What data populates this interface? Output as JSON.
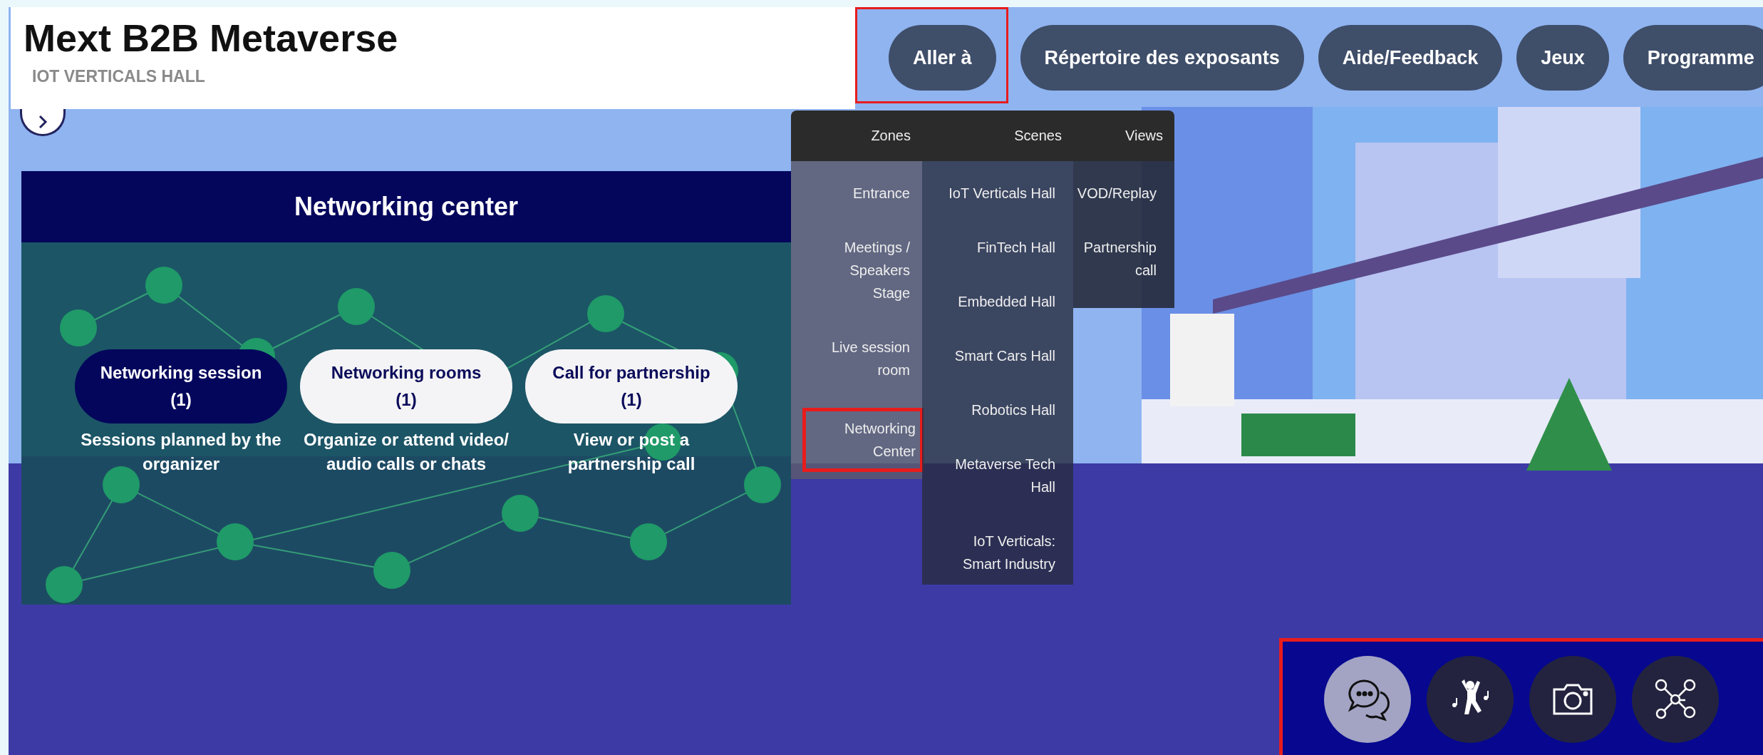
{
  "header": {
    "title": "Mext B2B Metaverse",
    "subtitle": "IOT VERTICALS HALL"
  },
  "nav": [
    {
      "label": "Aller à",
      "highlighted": true
    },
    {
      "label": "Répertoire des exposants",
      "highlighted": false
    },
    {
      "label": "Aide/Feedback",
      "highlighted": false
    },
    {
      "label": "Jeux",
      "highlighted": false
    },
    {
      "label": "Programme",
      "highlighted": false
    }
  ],
  "menu": {
    "columns": [
      {
        "heading": "Zones",
        "items": [
          {
            "label": "Entrance",
            "highlighted": false
          },
          {
            "label": "Meetings / Speakers Stage",
            "highlighted": false
          },
          {
            "label": "Live session room",
            "highlighted": false
          },
          {
            "label": "Networking Center",
            "highlighted": true
          }
        ]
      },
      {
        "heading": "Scenes",
        "items": [
          {
            "label": "IoT Verticals Hall",
            "highlighted": false
          },
          {
            "label": "FinTech Hall",
            "highlighted": false
          },
          {
            "label": "Embedded Hall",
            "highlighted": false
          },
          {
            "label": "Smart Cars Hall",
            "highlighted": false
          },
          {
            "label": "Robotics Hall",
            "highlighted": false
          },
          {
            "label": "Metaverse Tech Hall",
            "highlighted": false
          },
          {
            "label": "IoT Verticals: Smart Industry",
            "highlighted": false
          }
        ]
      },
      {
        "heading": "Views",
        "items": [
          {
            "label": "VOD/Replay",
            "highlighted": false
          },
          {
            "label": "Partnership call",
            "highlighted": false
          }
        ]
      }
    ]
  },
  "panel": {
    "title": "Networking center",
    "options": [
      {
        "label": "Networking session",
        "count": "(1)",
        "description": "Sessions planned by the organizer",
        "selected": true
      },
      {
        "label": "Networking rooms",
        "count": "(1)",
        "description": "Organize or attend video/ audio calls or chats",
        "selected": false
      },
      {
        "label": "Call for partnership",
        "count": "(1)",
        "description": "View or post a partnership call",
        "selected": false
      }
    ]
  },
  "toolbar": {
    "highlighted": true,
    "buttons": [
      {
        "kind": "chat",
        "selected": true
      },
      {
        "kind": "dance",
        "selected": false
      },
      {
        "kind": "camera",
        "selected": false
      },
      {
        "kind": "network",
        "selected": false
      }
    ]
  }
}
